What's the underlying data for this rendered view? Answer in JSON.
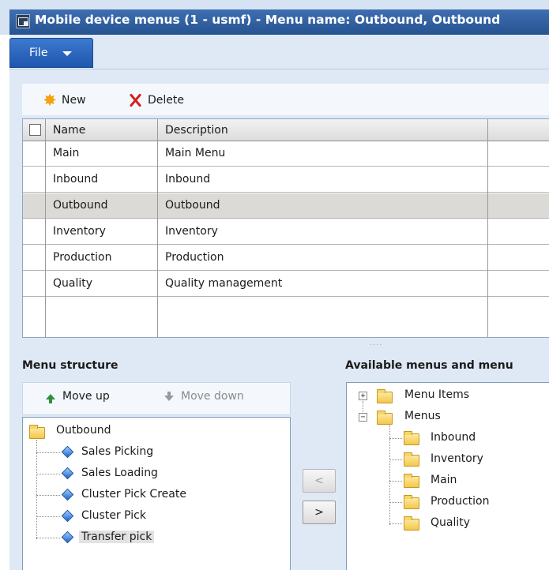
{
  "window": {
    "title": "Mobile device menus (1 - usmf) - Menu name: Outbound, Outbound"
  },
  "ribbon": {
    "file_label": "File"
  },
  "toolbar": {
    "new_label": "New",
    "delete_label": "Delete"
  },
  "grid": {
    "columns": [
      "Name",
      "Description"
    ],
    "rows": [
      {
        "name": "Main",
        "description": "Main Menu"
      },
      {
        "name": "Inbound",
        "description": "Inbound"
      },
      {
        "name": "Outbound",
        "description": "Outbound",
        "selected": true
      },
      {
        "name": "Inventory",
        "description": "Inventory"
      },
      {
        "name": "Production",
        "description": "Production"
      },
      {
        "name": "Quality",
        "description": "Quality management"
      }
    ]
  },
  "menu_structure": {
    "title": "Menu structure",
    "move_up_label": "Move up",
    "move_down_label": "Move down",
    "root": "Outbound",
    "items": [
      "Sales Picking",
      "Sales Loading",
      "Cluster Pick Create",
      "Cluster Pick",
      "Transfer pick"
    ],
    "selected_item": "Transfer pick"
  },
  "transfer_buttons": {
    "remove_label": "<",
    "add_label": ">"
  },
  "available": {
    "title": "Available menus and menu",
    "nodes": [
      {
        "label": "Menu Items",
        "expander": "+"
      },
      {
        "label": "Menus",
        "expander": "−"
      }
    ],
    "menus_children": [
      "Inbound",
      "Inventory",
      "Main",
      "Production",
      "Quality"
    ]
  },
  "colors": {
    "title_bar": "#2d5b9a",
    "selected_row": "#dcdad6",
    "panel_background": "#dfe9f5"
  }
}
